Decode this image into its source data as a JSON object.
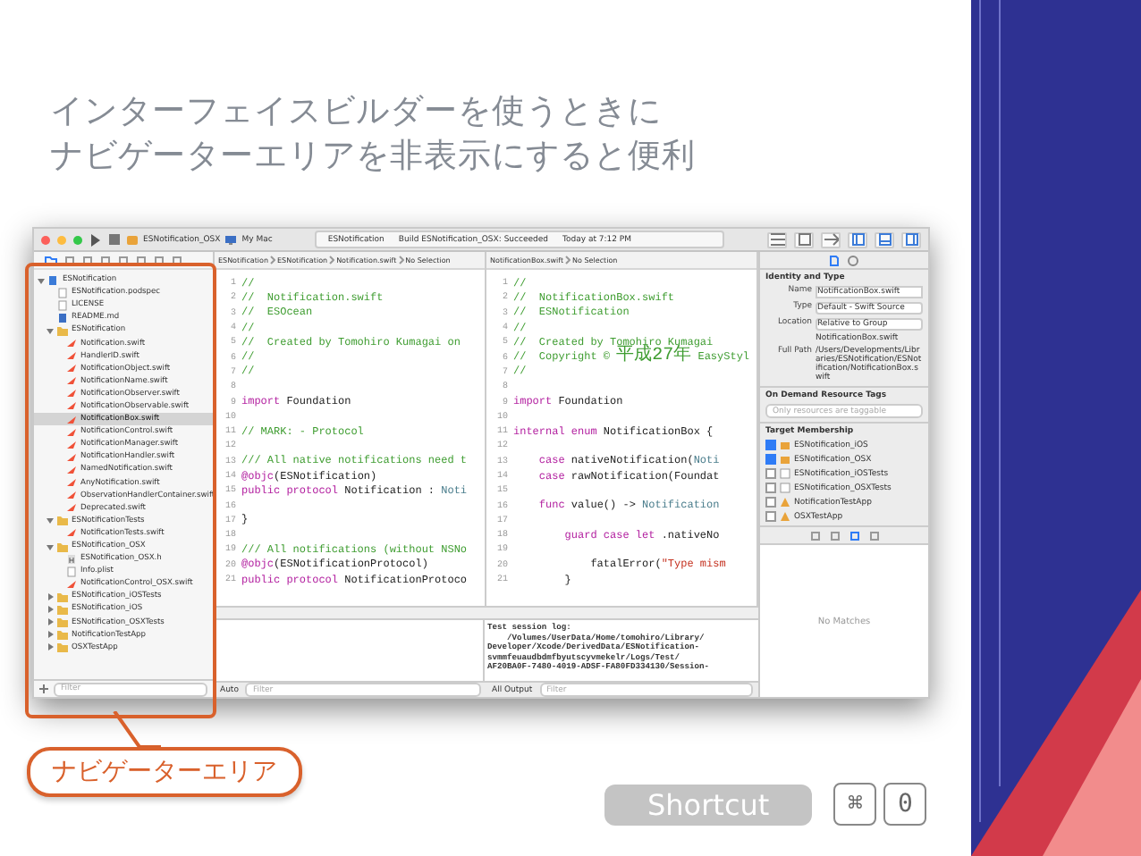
{
  "slide": {
    "title_lines": [
      "インターフェイスビルダーを使うときに",
      "ナビゲーターエリアを非表示にすると便利"
    ],
    "callout": "ナビゲーターエリア",
    "shortcut": {
      "label": "Shortcut",
      "keys": [
        "⌘",
        "0"
      ]
    }
  },
  "window": {
    "scheme": "ESNotification_OSX",
    "destination": "My Mac",
    "activity": [
      "ESNotification",
      "Build ESNotification_OSX: Succeeded",
      "Today at 7:12 PM"
    ]
  },
  "navigator": {
    "items": [
      {
        "label": "ESNotification",
        "kind": "project",
        "expanded": true,
        "selected": false,
        "children": [
          {
            "label": "ESNotification.podspec",
            "kind": "file",
            "selected": false
          },
          {
            "label": "LICENSE",
            "kind": "file",
            "selected": false
          },
          {
            "label": "README.md",
            "kind": "doc",
            "selected": false
          },
          {
            "label": "ESNotification",
            "kind": "folder",
            "expanded": true,
            "selected": false,
            "children": [
              {
                "label": "Notification.swift",
                "kind": "swift",
                "selected": false
              },
              {
                "label": "HandlerID.swift",
                "kind": "swift",
                "selected": false
              },
              {
                "label": "NotificationObject.swift",
                "kind": "swift",
                "selected": false
              },
              {
                "label": "NotificationName.swift",
                "kind": "swift",
                "selected": false
              },
              {
                "label": "NotificationObserver.swift",
                "kind": "swift",
                "selected": false
              },
              {
                "label": "NotificationObservable.swift",
                "kind": "swift",
                "selected": false
              },
              {
                "label": "NotificationBox.swift",
                "kind": "swift",
                "selected": true
              },
              {
                "label": "NotificationControl.swift",
                "kind": "swift",
                "selected": false
              },
              {
                "label": "NotificationManager.swift",
                "kind": "swift",
                "selected": false
              },
              {
                "label": "NotificationHandler.swift",
                "kind": "swift",
                "selected": false
              },
              {
                "label": "NamedNotification.swift",
                "kind": "swift",
                "selected": false
              },
              {
                "label": "AnyNotification.swift",
                "kind": "swift",
                "selected": false
              },
              {
                "label": "ObservationHandlerContainer.swift",
                "kind": "swift",
                "selected": false
              },
              {
                "label": "Deprecated.swift",
                "kind": "swift",
                "selected": false
              }
            ]
          },
          {
            "label": "ESNotificationTests",
            "kind": "folder",
            "expanded": true,
            "selected": false,
            "children": [
              {
                "label": "NotificationTests.swift",
                "kind": "swift",
                "selected": false
              }
            ]
          },
          {
            "label": "ESNotification_OSX",
            "kind": "folder",
            "expanded": true,
            "selected": false,
            "children": [
              {
                "label": "ESNotification_OSX.h",
                "kind": "header",
                "selected": false
              },
              {
                "label": "Info.plist",
                "kind": "file",
                "selected": false
              },
              {
                "label": "NotificationControl_OSX.swift",
                "kind": "swift",
                "selected": false
              }
            ]
          },
          {
            "label": "ESNotification_iOSTests",
            "kind": "folder",
            "expanded": false,
            "selected": false
          },
          {
            "label": "ESNotification_iOS",
            "kind": "folder",
            "expanded": false,
            "selected": false
          },
          {
            "label": "ESNotification_OSXTests",
            "kind": "folder",
            "expanded": false,
            "selected": false
          },
          {
            "label": "NotificationTestApp",
            "kind": "folder",
            "expanded": false,
            "selected": false
          },
          {
            "label": "OSXTestApp",
            "kind": "folder",
            "expanded": false,
            "selected": false
          }
        ]
      }
    ],
    "filter_placeholder": "Filter"
  },
  "editors": [
    {
      "jump_path": [
        "ESNotification",
        "ESNotification",
        "Notification.swift",
        "No Selection"
      ],
      "lines": [
        {
          "number": "1",
          "parts": [
            {
              "text": "//",
              "kind": "comment"
            }
          ]
        },
        {
          "number": "2",
          "parts": [
            {
              "text": "//  Notification.swift",
              "kind": "comment"
            }
          ]
        },
        {
          "number": "3",
          "parts": [
            {
              "text": "//  ESOcean",
              "kind": "comment"
            }
          ]
        },
        {
          "number": "4",
          "parts": [
            {
              "text": "//",
              "kind": "comment"
            }
          ]
        },
        {
          "number": "5",
          "parts": [
            {
              "text": "//  Created by Tomohiro Kumagai on",
              "kind": "comment"
            }
          ]
        },
        {
          "number": "6",
          "parts": [
            {
              "text": "//",
              "kind": "comment"
            }
          ]
        },
        {
          "number": "7",
          "parts": [
            {
              "text": "//",
              "kind": "comment"
            }
          ]
        },
        {
          "number": "8"
        },
        {
          "number": "9",
          "parts": [
            {
              "text": "import",
              "kind": "keyword"
            },
            {
              "text": " Foundation",
              "kind": "plain"
            }
          ]
        },
        {
          "number": "10"
        },
        {
          "number": "11",
          "parts": [
            {
              "text": "// MARK: - Protocol",
              "kind": "comment"
            }
          ]
        },
        {
          "number": "12"
        },
        {
          "number": "13",
          "parts": [
            {
              "text": "/// All native notifications need t",
              "kind": "comment"
            }
          ]
        },
        {
          "number": "14",
          "parts": [
            {
              "text": "@objc",
              "kind": "keyword"
            },
            {
              "text": "(ESNotification)",
              "kind": "plain"
            }
          ]
        },
        {
          "number": "15",
          "parts": [
            {
              "text": "public protocol",
              "kind": "keyword"
            },
            {
              "text": " Notification : ",
              "kind": "plain"
            },
            {
              "text": "Noti",
              "kind": "type"
            }
          ]
        },
        {
          "number": "16"
        },
        {
          "number": "17",
          "parts": [
            {
              "text": "}",
              "kind": "plain"
            }
          ]
        },
        {
          "number": "18"
        },
        {
          "number": "19",
          "parts": [
            {
              "text": "/// All notifications (without NSNo",
              "kind": "comment"
            }
          ]
        },
        {
          "number": "20",
          "parts": [
            {
              "text": "@objc",
              "kind": "keyword"
            },
            {
              "text": "(ESNotificationProtocol)",
              "kind": "plain"
            }
          ]
        },
        {
          "number": "21",
          "parts": [
            {
              "text": "public protocol",
              "kind": "keyword"
            },
            {
              "text": " NotificationProtoco",
              "kind": "plain"
            }
          ]
        }
      ]
    },
    {
      "jump_path": [
        "NotificationBox.swift",
        "No Selection"
      ],
      "lines": [
        {
          "number": "1",
          "parts": [
            {
              "text": "//",
              "kind": "comment"
            }
          ]
        },
        {
          "number": "2",
          "parts": [
            {
              "text": "//  NotificationBox.swift",
              "kind": "comment"
            }
          ]
        },
        {
          "number": "3",
          "parts": [
            {
              "text": "//  ESNotification",
              "kind": "comment"
            }
          ]
        },
        {
          "number": "4",
          "parts": [
            {
              "text": "//",
              "kind": "comment"
            }
          ]
        },
        {
          "number": "5",
          "parts": [
            {
              "text": "//  Created by Tomohiro Kumagai",
              "kind": "comment"
            }
          ]
        },
        {
          "number": "6",
          "parts": [
            {
              "text": "//  Copyright © ",
              "kind": "comment"
            },
            {
              "text": "平成27年",
              "kind": "cjk"
            },
            {
              "text": " EasyStyl",
              "kind": "comment"
            }
          ]
        },
        {
          "number": "7",
          "parts": [
            {
              "text": "//",
              "kind": "comment"
            }
          ]
        },
        {
          "number": "8"
        },
        {
          "number": "9",
          "parts": [
            {
              "text": "import",
              "kind": "keyword"
            },
            {
              "text": " Foundation",
              "kind": "plain"
            }
          ]
        },
        {
          "number": "10"
        },
        {
          "number": "11",
          "parts": [
            {
              "text": "internal enum",
              "kind": "keyword"
            },
            {
              "text": " NotificationBox {",
              "kind": "plain"
            }
          ]
        },
        {
          "number": "12"
        },
        {
          "number": "13",
          "parts": [
            {
              "text": "    case",
              "kind": "keyword"
            },
            {
              "text": " nativeNotification(",
              "kind": "plain"
            },
            {
              "text": "Noti",
              "kind": "type"
            }
          ]
        },
        {
          "number": "14",
          "parts": [
            {
              "text": "    case",
              "kind": "keyword"
            },
            {
              "text": " rawNotification(Foundat",
              "kind": "plain"
            }
          ]
        },
        {
          "number": "15"
        },
        {
          "number": "16",
          "parts": [
            {
              "text": "    func",
              "kind": "keyword"
            },
            {
              "text": " value() -> ",
              "kind": "plain"
            },
            {
              "text": "Notification",
              "kind": "type"
            }
          ]
        },
        {
          "number": "17"
        },
        {
          "number": "18",
          "parts": [
            {
              "text": "        guard case let",
              "kind": "keyword"
            },
            {
              "text": " .nativeNo",
              "kind": "plain"
            }
          ]
        },
        {
          "number": "19"
        },
        {
          "number": "20",
          "parts": [
            {
              "text": "            fatalError(",
              "kind": "plain"
            },
            {
              "text": "\"Type mism",
              "kind": "string"
            }
          ]
        },
        {
          "number": "21",
          "parts": [
            {
              "text": "        }",
              "kind": "plain"
            }
          ]
        }
      ]
    }
  ],
  "debug": {
    "log": "Test session log:\n    /Volumes/UserData/Home/tomohiro/Library/\nDeveloper/Xcode/DerivedData/ESNotification-\nsvmmfeuaudbdmfbyutscyvmekelr/Logs/Test/\nAF20BA0F-7480-4019-ADSF-FA80FD334130/Session-",
    "variables_mode": "Auto",
    "variables_filter_placeholder": "Filter",
    "output_mode": "All Output",
    "output_filter_placeholder": "Filter"
  },
  "inspector": {
    "section": "Identity and Type",
    "fields": [
      {
        "label": "Name",
        "value": "NotificationBox.swift",
        "kind": "text"
      },
      {
        "label": "Type",
        "value": "Default - Swift Source",
        "kind": "popup"
      },
      {
        "label": "Location",
        "value": "Relative to Group",
        "kind": "popup"
      },
      {
        "value": "NotificationBox.swift",
        "kind": "plain"
      },
      {
        "label": "Full Path",
        "value": "/Users/Developments/Libraries/ESNotification/ESNotification/NotificationBox.swift",
        "kind": "plain"
      }
    ],
    "tags_title": "On Demand Resource Tags",
    "tags_placeholder": "Only resources are taggable",
    "membership_title": "Target Membership",
    "targets": [
      {
        "label": "ESNotification_iOS",
        "kind": "framework",
        "checked": true
      },
      {
        "label": "ESNotification_OSX",
        "kind": "framework",
        "checked": true
      },
      {
        "label": "ESNotification_iOSTests",
        "kind": "tests",
        "checked": false
      },
      {
        "label": "ESNotification_OSXTests",
        "kind": "tests",
        "checked": false
      },
      {
        "label": "NotificationTestApp",
        "kind": "app",
        "checked": false
      },
      {
        "label": "OSXTestApp",
        "kind": "app",
        "checked": false
      }
    ],
    "library_empty": "No Matches"
  }
}
